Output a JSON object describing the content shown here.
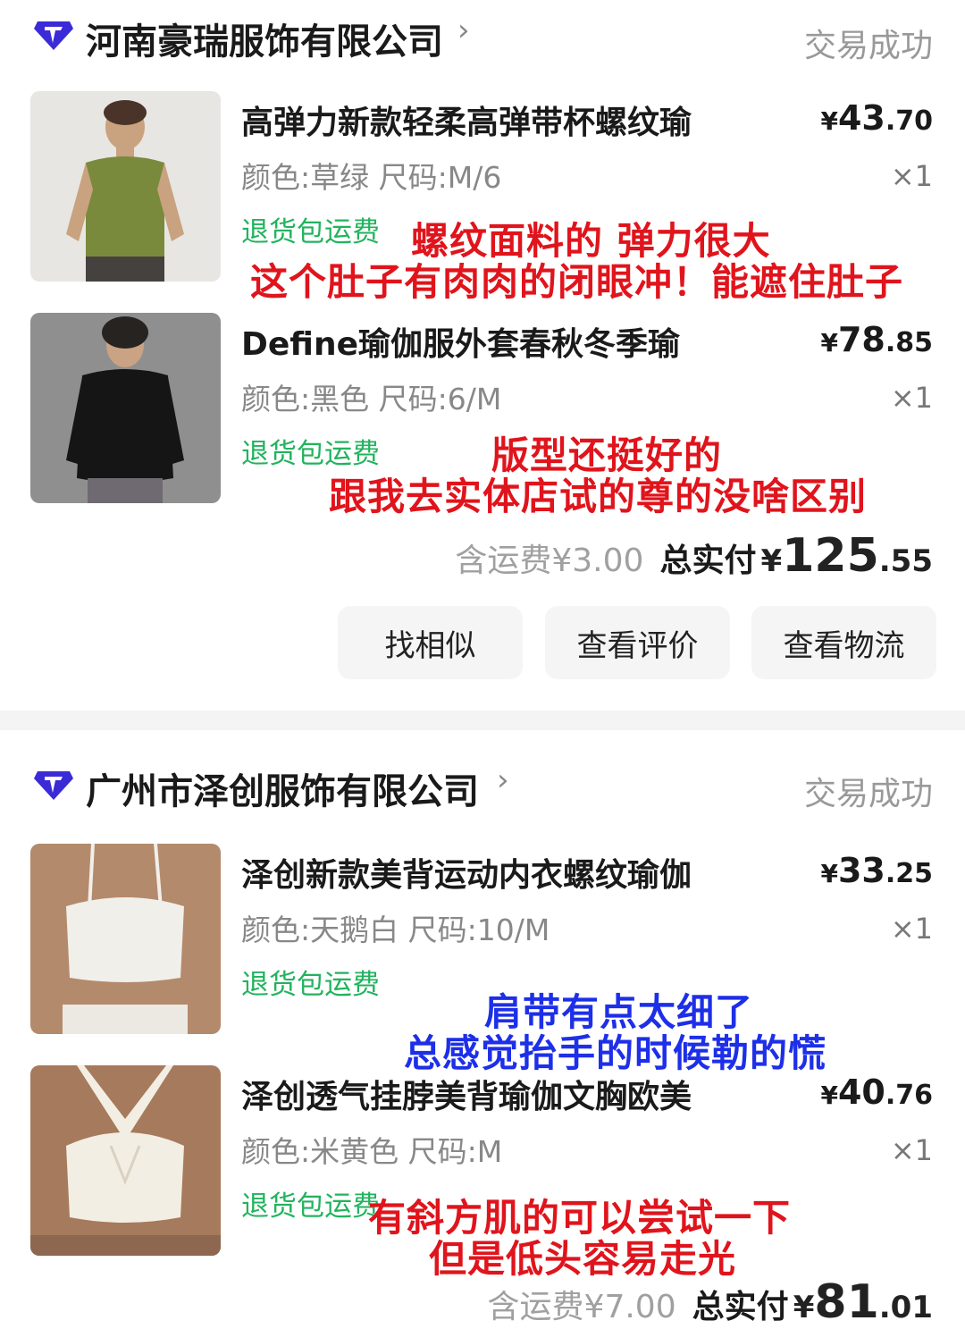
{
  "orders": [
    {
      "shop_name": "河南豪瑞服饰有限公司",
      "arrow": "›",
      "status": "交易成功",
      "items": [
        {
          "title": "高弹力新款轻柔高弹带杯螺纹瑜",
          "spec": "颜色:草绿 尺码:M/6",
          "tag": "退货包运费",
          "price_currency": "¥",
          "price_int": "43",
          "price_dec": ".70",
          "qty": "×1",
          "note_lines": [
            "螺纹面料的 弹力很大",
            "这个肚子有肉肉的闭眼冲！能遮住肚子"
          ]
        },
        {
          "title": "Define瑜伽服外套春秋冬季瑜",
          "spec": "颜色:黑色 尺码:6/M",
          "tag": "退货包运费",
          "price_currency": "¥",
          "price_int": "78",
          "price_dec": ".85",
          "qty": "×1",
          "note_lines": [
            "版型还挺好的",
            "跟我去实体店试的尊的没啥区别"
          ]
        }
      ],
      "shipping": "含运费¥3.00",
      "total_label": "总实付",
      "total_currency": "¥",
      "total_int": "125",
      "total_dec": ".55",
      "buttons": [
        "找相似",
        "查看评价",
        "查看物流"
      ]
    },
    {
      "shop_name": "广州市泽创服饰有限公司",
      "arrow": "›",
      "status": "交易成功",
      "items": [
        {
          "title": "泽创新款美背运动内衣螺纹瑜伽",
          "spec": "颜色:天鹅白 尺码:10/M",
          "tag": "退货包运费",
          "price_currency": "¥",
          "price_int": "33",
          "price_dec": ".25",
          "qty": "×1",
          "note_lines": [
            "肩带有点太细了",
            "总感觉抬手的时候勒的慌"
          ]
        },
        {
          "title": "泽创透气挂脖美背瑜伽文胸欧美",
          "spec": "颜色:米黄色 尺码:M",
          "tag": "退货包运费",
          "price_currency": "¥",
          "price_int": "40",
          "price_dec": ".76",
          "qty": "×1",
          "note_lines": [
            "有斜方肌的可以尝试一下",
            "但是低头容易走光"
          ]
        }
      ],
      "shipping": "含运费¥7.00",
      "total_label": "总实付",
      "total_currency": "¥",
      "total_int": "81",
      "total_dec": ".01"
    }
  ],
  "colors": {
    "note_red": "#e0141c",
    "note_blue": "#1d2fe8",
    "tag_green": "#22b35e",
    "shop_icon": "#3b2bd6"
  }
}
